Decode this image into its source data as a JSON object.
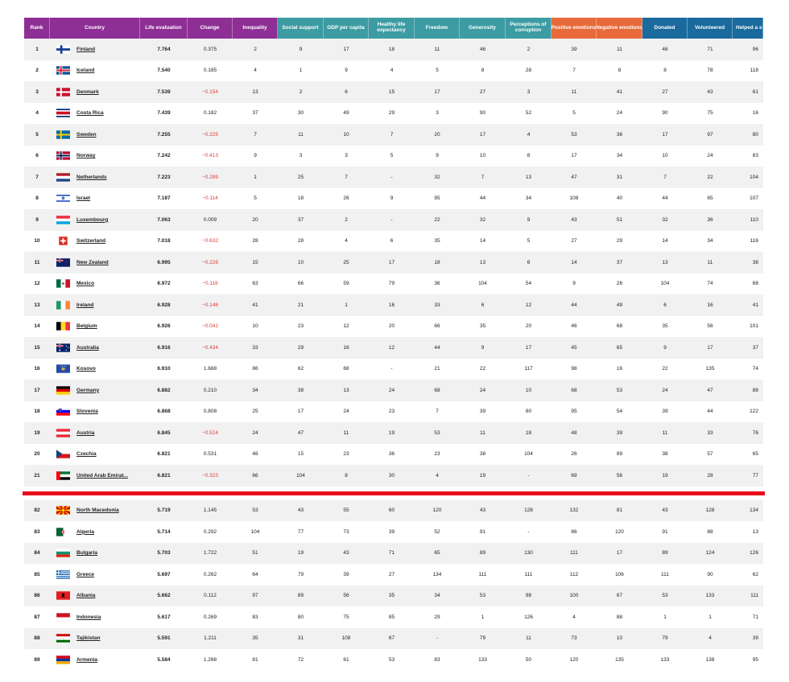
{
  "headers": [
    {
      "label": "Rank",
      "group": "purple"
    },
    {
      "label": "Country",
      "group": "purple"
    },
    {
      "label": "Life evaluation",
      "group": "purple"
    },
    {
      "label": "Change",
      "group": "purple"
    },
    {
      "label": "Inequality",
      "group": "purple"
    },
    {
      "label": "Social support",
      "group": "teal"
    },
    {
      "label": "GDP per capita",
      "group": "teal"
    },
    {
      "label": "Healthy life expectancy",
      "group": "teal"
    },
    {
      "label": "Freedom",
      "group": "teal"
    },
    {
      "label": "Generosity",
      "group": "teal"
    },
    {
      "label": "Perceptions of corruption",
      "group": "teal"
    },
    {
      "label": "Positive emotions",
      "group": "orange"
    },
    {
      "label": "Negative emotions",
      "group": "orange"
    },
    {
      "label": "Donated",
      "group": "blue"
    },
    {
      "label": "Volunteered",
      "group": "blue"
    },
    {
      "label": "Helped a stranger",
      "group": "blue"
    }
  ],
  "colors": {
    "purple": "#8e2f95",
    "teal": "#3d9ca3",
    "orange": "#e86a3a",
    "blue": "#1a6a9e",
    "negative": "#e53935",
    "divider": "#e8101c"
  },
  "top_rows": [
    {
      "rank": "1",
      "country": "Finland",
      "flag": "finland",
      "life": "7.764",
      "change": "0.375",
      "neg": false,
      "vals": [
        "2",
        "9",
        "17",
        "18",
        "11",
        "46",
        "2",
        "39",
        "11",
        "46",
        "71",
        "96"
      ]
    },
    {
      "rank": "2",
      "country": "Iceland",
      "flag": "iceland",
      "life": "7.540",
      "change": "0.185",
      "neg": false,
      "vals": [
        "4",
        "1",
        "9",
        "4",
        "5",
        "8",
        "28",
        "7",
        "8",
        "8",
        "78",
        "118"
      ]
    },
    {
      "rank": "3",
      "country": "Denmark",
      "flag": "denmark",
      "life": "7.539",
      "change": "−0.154",
      "neg": true,
      "vals": [
        "13",
        "2",
        "6",
        "15",
        "17",
        "27",
        "3",
        "11",
        "41",
        "27",
        "43",
        "61"
      ]
    },
    {
      "rank": "4",
      "country": "Costa Rica",
      "flag": "costarica",
      "life": "7.439",
      "change": "0.182",
      "neg": false,
      "vals": [
        "37",
        "30",
        "49",
        "29",
        "3",
        "90",
        "52",
        "5",
        "24",
        "90",
        "75",
        "16"
      ]
    },
    {
      "rank": "5",
      "country": "Sweden",
      "flag": "sweden",
      "life": "7.255",
      "change": "−0.225",
      "neg": true,
      "vals": [
        "7",
        "11",
        "10",
        "7",
        "20",
        "17",
        "4",
        "53",
        "36",
        "17",
        "97",
        "80"
      ]
    },
    {
      "rank": "6",
      "country": "Norway",
      "flag": "norway",
      "life": "7.242",
      "change": "−0.413",
      "neg": true,
      "vals": [
        "9",
        "3",
        "3",
        "5",
        "9",
        "10",
        "8",
        "17",
        "34",
        "10",
        "24",
        "83"
      ]
    },
    {
      "rank": "7",
      "country": "Netherlands",
      "flag": "netherlands",
      "life": "7.223",
      "change": "−0.289",
      "neg": true,
      "vals": [
        "1",
        "25",
        "7",
        "-",
        "32",
        "7",
        "13",
        "47",
        "31",
        "7",
        "22",
        "104"
      ]
    },
    {
      "rank": "8",
      "country": "Israel",
      "flag": "israel",
      "life": "7.187",
      "change": "−0.114",
      "neg": true,
      "vals": [
        "5",
        "18",
        "26",
        "9",
        "95",
        "44",
        "34",
        "108",
        "40",
        "44",
        "65",
        "107"
      ]
    },
    {
      "rank": "9",
      "country": "Luxembourg",
      "flag": "luxembourg",
      "life": "7.063",
      "change": "0.009",
      "neg": false,
      "vals": [
        "20",
        "37",
        "2",
        "-",
        "22",
        "32",
        "9",
        "43",
        "51",
        "32",
        "36",
        "110"
      ]
    },
    {
      "rank": "10",
      "country": "Switzerland",
      "flag": "switzerland",
      "life": "7.018",
      "change": "−0.632",
      "neg": true,
      "vals": [
        "28",
        "28",
        "4",
        "6",
        "35",
        "14",
        "5",
        "27",
        "29",
        "14",
        "34",
        "116"
      ]
    },
    {
      "rank": "11",
      "country": "New Zealand",
      "flag": "newzealand",
      "life": "6.995",
      "change": "−0.226",
      "neg": true,
      "vals": [
        "15",
        "10",
        "25",
        "17",
        "18",
        "13",
        "6",
        "14",
        "37",
        "13",
        "11",
        "38"
      ]
    },
    {
      "rank": "12",
      "country": "Mexico",
      "flag": "mexico",
      "life": "6.972",
      "change": "−0.116",
      "neg": true,
      "vals": [
        "63",
        "66",
        "59",
        "79",
        "36",
        "104",
        "54",
        "9",
        "26",
        "104",
        "74",
        "68"
      ]
    },
    {
      "rank": "13",
      "country": "Ireland",
      "flag": "ireland",
      "life": "6.928",
      "change": "−0.148",
      "neg": true,
      "vals": [
        "41",
        "21",
        "1",
        "16",
        "33",
        "6",
        "12",
        "44",
        "49",
        "6",
        "16",
        "41"
      ]
    },
    {
      "rank": "14",
      "country": "Belgium",
      "flag": "belgium",
      "life": "6.926",
      "change": "−0.041",
      "neg": true,
      "vals": [
        "10",
        "23",
        "12",
        "20",
        "66",
        "35",
        "20",
        "46",
        "68",
        "35",
        "56",
        "101"
      ]
    },
    {
      "rank": "15",
      "country": "Australia",
      "flag": "australia",
      "life": "6.916",
      "change": "−0.434",
      "neg": true,
      "vals": [
        "33",
        "29",
        "16",
        "12",
        "44",
        "9",
        "17",
        "45",
        "65",
        "9",
        "17",
        "37"
      ]
    },
    {
      "rank": "16",
      "country": "Kosovo",
      "flag": "kosovo",
      "life": "6.910",
      "change": "1.688",
      "neg": false,
      "vals": [
        "86",
        "62",
        "68",
        "-",
        "21",
        "22",
        "117",
        "98",
        "16",
        "22",
        "135",
        "74"
      ]
    },
    {
      "rank": "17",
      "country": "Germany",
      "flag": "germany",
      "life": "6.882",
      "change": "0.210",
      "neg": false,
      "vals": [
        "34",
        "38",
        "13",
        "24",
        "68",
        "24",
        "10",
        "68",
        "53",
        "24",
        "47",
        "88"
      ]
    },
    {
      "rank": "18",
      "country": "Slovenia",
      "flag": "slovenia",
      "life": "6.868",
      "change": "0.808",
      "neg": false,
      "vals": [
        "25",
        "17",
        "24",
        "23",
        "7",
        "39",
        "80",
        "95",
        "54",
        "39",
        "44",
        "122"
      ]
    },
    {
      "rank": "19",
      "country": "Austria",
      "flag": "austria",
      "life": "6.845",
      "change": "−0.524",
      "neg": true,
      "vals": [
        "24",
        "47",
        "11",
        "19",
        "53",
        "11",
        "18",
        "48",
        "39",
        "11",
        "33",
        "76"
      ]
    },
    {
      "rank": "20",
      "country": "Czechia",
      "flag": "czechia",
      "life": "6.821",
      "change": "0.531",
      "neg": false,
      "vals": [
        "48",
        "15",
        "23",
        "36",
        "23",
        "38",
        "104",
        "26",
        "89",
        "38",
        "57",
        "65"
      ]
    },
    {
      "rank": "21",
      "country": "United Arab Emirat...",
      "flag": "uae",
      "life": "6.821",
      "change": "−0.323",
      "neg": true,
      "vals": [
        "66",
        "104",
        "8",
        "30",
        "4",
        "19",
        "-",
        "69",
        "56",
        "19",
        "28",
        "77"
      ]
    }
  ],
  "bottom_rows": [
    {
      "rank": "82",
      "country": "North Macedonia",
      "flag": "northmacedonia",
      "life": "5.719",
      "change": "1.145",
      "neg": false,
      "vals": [
        "53",
        "43",
        "55",
        "60",
        "120",
        "43",
        "128",
        "132",
        "81",
        "43",
        "128",
        "134"
      ]
    },
    {
      "rank": "83",
      "country": "Algeria",
      "flag": "algeria",
      "life": "5.714",
      "change": "0.292",
      "neg": false,
      "vals": [
        "104",
        "77",
        "73",
        "39",
        "52",
        "91",
        "-",
        "86",
        "120",
        "91",
        "88",
        "13"
      ]
    },
    {
      "rank": "84",
      "country": "Bulgaria",
      "flag": "bulgaria",
      "life": "5.703",
      "change": "1.722",
      "neg": false,
      "vals": [
        "51",
        "19",
        "43",
        "71",
        "65",
        "89",
        "130",
        "111",
        "17",
        "89",
        "124",
        "126"
      ]
    },
    {
      "rank": "85",
      "country": "Greece",
      "flag": "greece",
      "life": "5.697",
      "change": "0.262",
      "neg": false,
      "vals": [
        "64",
        "79",
        "39",
        "27",
        "134",
        "111",
        "111",
        "112",
        "106",
        "111",
        "90",
        "62"
      ]
    },
    {
      "rank": "86",
      "country": "Albania",
      "flag": "albania",
      "life": "5.662",
      "change": "0.112",
      "neg": false,
      "vals": [
        "97",
        "89",
        "56",
        "35",
        "34",
        "53",
        "98",
        "100",
        "67",
        "53",
        "133",
        "111"
      ]
    },
    {
      "rank": "87",
      "country": "Indonesia",
      "flag": "indonesia",
      "life": "5.617",
      "change": "0.269",
      "neg": false,
      "vals": [
        "83",
        "80",
        "75",
        "85",
        "29",
        "1",
        "126",
        "4",
        "88",
        "1",
        "1",
        "71"
      ]
    },
    {
      "rank": "88",
      "country": "Tajikistan",
      "flag": "tajikistan",
      "life": "5.591",
      "change": "1.211",
      "neg": false,
      "vals": [
        "35",
        "31",
        "108",
        "67",
        "-",
        "79",
        "11",
        "73",
        "10",
        "79",
        "4",
        "39"
      ]
    },
    {
      "rank": "89",
      "country": "Armenia",
      "flag": "armenia",
      "life": "5.584",
      "change": "1.268",
      "neg": false,
      "vals": [
        "81",
        "72",
        "61",
        "53",
        "83",
        "133",
        "50",
        "120",
        "135",
        "133",
        "138",
        "95"
      ]
    }
  ]
}
